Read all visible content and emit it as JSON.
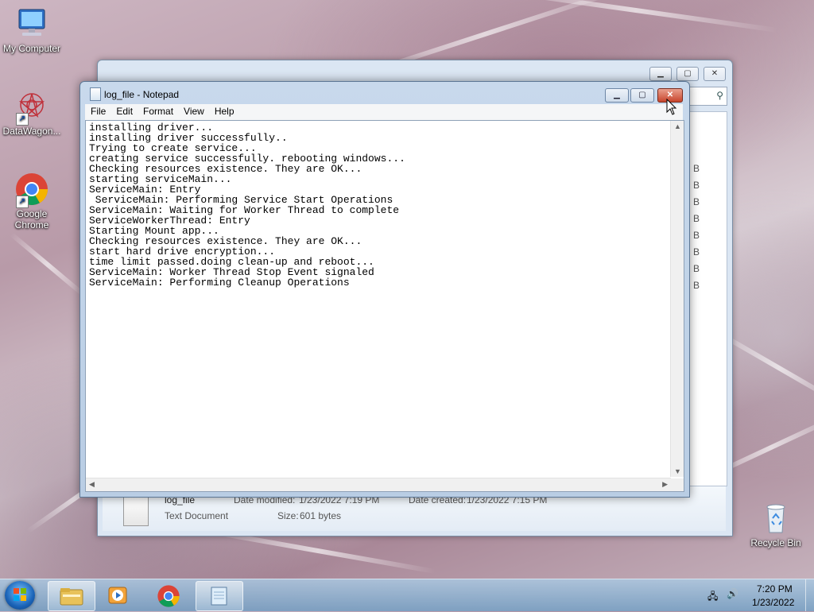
{
  "desktop": {
    "icons": [
      {
        "label": "My Computer"
      },
      {
        "label": "DataWagon..."
      },
      {
        "label": "Google Chrome"
      },
      {
        "label": "Recycle Bin"
      }
    ]
  },
  "explorer": {
    "file_name": "log_file",
    "file_type": "Text Document",
    "date_modified_label": "Date modified:",
    "date_modified_value": "1/23/2022 7:19 PM",
    "date_created_label": "Date created:",
    "date_created_value": "1/23/2022 7:15 PM",
    "size_label": "Size:",
    "size_value": "601 bytes",
    "size_column": [
      "B",
      "B",
      "B",
      "B",
      "B",
      "B",
      "B",
      "B"
    ]
  },
  "notepad": {
    "title": "log_file - Notepad",
    "menu": [
      "File",
      "Edit",
      "Format",
      "View",
      "Help"
    ],
    "lines": [
      "installing driver...",
      "installing driver successfully..",
      "Trying to create service...",
      "creating service successfully. rebooting windows...",
      "Checking resources existence. They are OK...",
      "starting serviceMain...",
      "ServiceMain: Entry",
      " ServiceMain: Performing Service Start Operations",
      "ServiceMain: Waiting for Worker Thread to complete",
      "ServiceWorkerThread: Entry",
      "Starting Mount app...",
      "Checking resources existence. They are OK...",
      "start hard drive encryption...",
      "time limit passed.doing clean-up and reboot...",
      "ServiceMain: Worker Thread Stop Event signaled",
      "ServiceMain: Performing Cleanup Operations"
    ]
  },
  "taskbar": {
    "time": "7:20 PM",
    "date": "1/23/2022"
  }
}
